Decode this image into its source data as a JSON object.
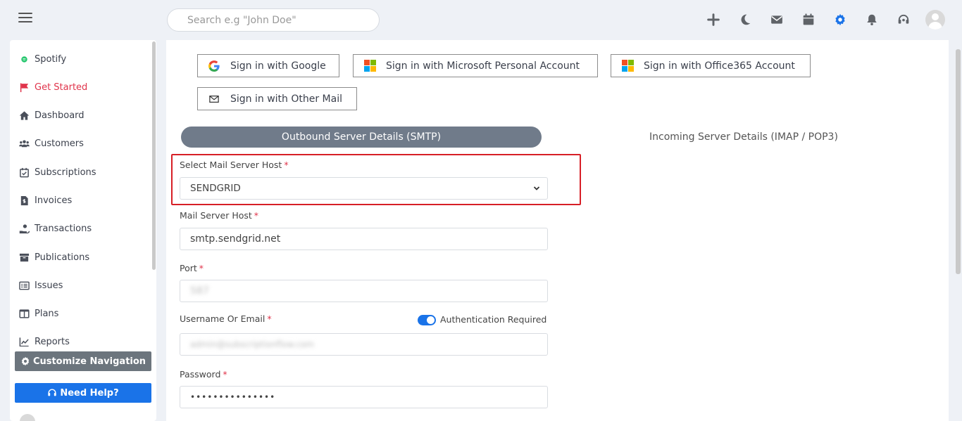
{
  "search": {
    "placeholder": "Search e.g \"John Doe\""
  },
  "topbar": {
    "icons": [
      "plus-icon",
      "moon-icon",
      "mail-icon",
      "calendar-icon",
      "gear-icon",
      "bell-icon",
      "headset-icon",
      "user-avatar"
    ],
    "accent": "#1a73e8"
  },
  "sidebar": {
    "items": [
      {
        "label": "Spotify",
        "icon": "status-dot-icon"
      },
      {
        "label": "Get Started",
        "icon": "flag-icon",
        "active": true
      },
      {
        "label": "Dashboard",
        "icon": "home-icon"
      },
      {
        "label": "Customers",
        "icon": "users-icon"
      },
      {
        "label": "Subscriptions",
        "icon": "calendar-check-icon"
      },
      {
        "label": "Invoices",
        "icon": "invoice-icon"
      },
      {
        "label": "Transactions",
        "icon": "hand-coin-icon"
      },
      {
        "label": "Publications",
        "icon": "archive-icon"
      },
      {
        "label": "Issues",
        "icon": "list-icon"
      },
      {
        "label": "Plans",
        "icon": "columns-icon"
      },
      {
        "label": "Reports",
        "icon": "chart-line-icon"
      }
    ],
    "customize_label": "Customize Navigation",
    "help_label": "Need Help?",
    "active_color": "#e0344b"
  },
  "signin": {
    "google": "Sign in with Google",
    "microsoft": "Sign in with Microsoft Personal Account",
    "office365": "Sign in with Office365 Account",
    "other": "Sign in with Other Mail"
  },
  "tabs": {
    "outbound": "Outbound Server Details (SMTP)",
    "incoming": "Incoming Server Details (IMAP / POP3)"
  },
  "form": {
    "select_host_label": "Select Mail Server Host",
    "select_host_value": "SENDGRID",
    "host_label": "Mail Server Host",
    "host_value": "smtp.sendgrid.net",
    "port_label": "Port",
    "port_value": "587",
    "username_label": "Username Or Email",
    "username_value": "admin@subscriptionflow.com",
    "auth_label": "Authentication Required",
    "auth_enabled": true,
    "password_label": "Password",
    "password_value": "•••••••••••••••",
    "required_mark": "*"
  }
}
